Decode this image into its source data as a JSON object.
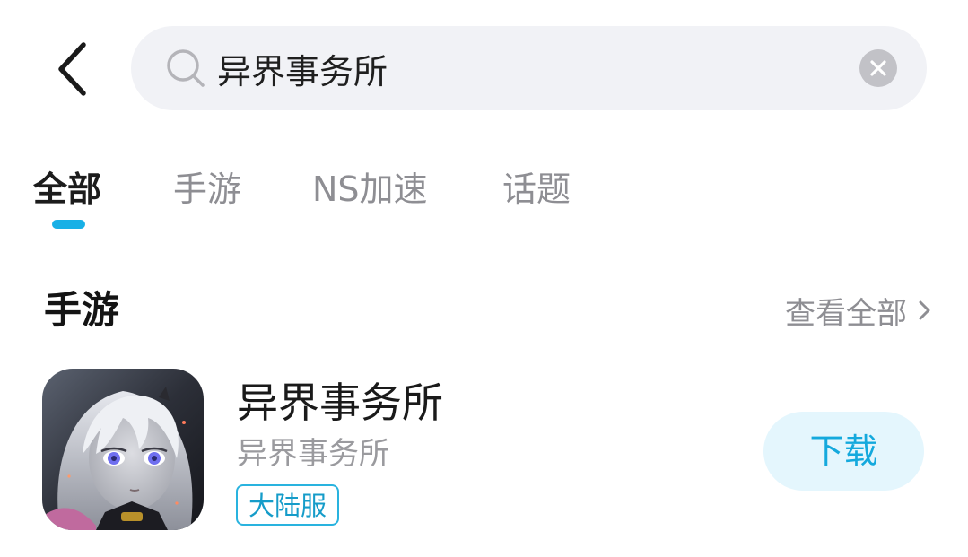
{
  "search": {
    "value": "异界事务所",
    "back_icon": "back-chevron-icon",
    "search_icon": "search-icon",
    "clear_icon": "clear-icon"
  },
  "tabs": [
    {
      "label": "全部",
      "active": true
    },
    {
      "label": "手游",
      "active": false
    },
    {
      "label": "NS加速",
      "active": false
    },
    {
      "label": "话题",
      "active": false
    }
  ],
  "section": {
    "title": "手游",
    "see_all_label": "查看全部",
    "see_all_icon": "chevron-right-icon"
  },
  "game": {
    "name": "异界事务所",
    "subtitle": "异界事务所",
    "tag": "大陆服",
    "download_label": "下载"
  },
  "colors": {
    "accent": "#18b0e6",
    "download_bg": "#e4f6fd",
    "search_bg": "#f1f2f6"
  }
}
